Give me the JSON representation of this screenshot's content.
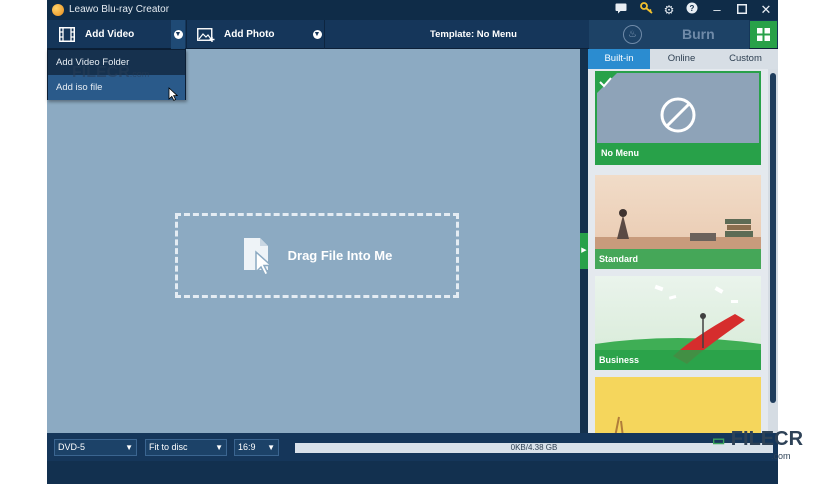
{
  "window": {
    "title": "Leawo Blu-ray Creator"
  },
  "toolbar": {
    "add_video": "Add Video",
    "add_photo": "Add Photo",
    "template_label": "Template: No Menu",
    "burn": "Burn"
  },
  "menu": {
    "items": [
      "Add Video Folder",
      "Add iso file"
    ]
  },
  "drop_zone": {
    "text": "Drag File Into Me"
  },
  "right_panel": {
    "tabs": [
      "Built-in",
      "Online",
      "Custom"
    ],
    "templates": [
      "No Menu",
      "Standard",
      "Business",
      ""
    ]
  },
  "statusbar": {
    "disc_type": "DVD-5",
    "fit_mode": "Fit to disc",
    "aspect": "16:9",
    "capacity": "0KB/4.38 GB",
    "capacity_fraction": 0.0
  },
  "watermark": {
    "brand": "FILECR",
    "domain": ".com"
  },
  "colors": {
    "accent_green": "#28a149",
    "toolbar_bg": "#15365a",
    "drop_bg": "#8caac2",
    "tab_active": "#2b8cd0"
  }
}
